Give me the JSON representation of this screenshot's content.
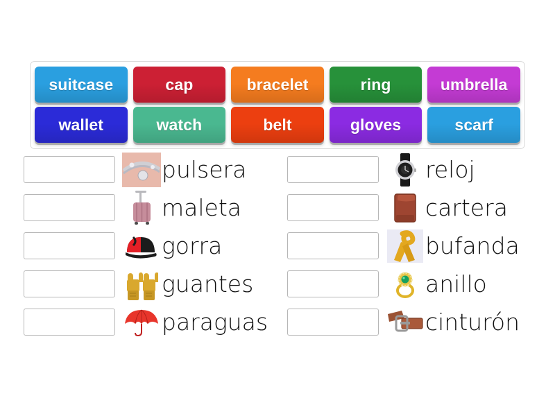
{
  "activity": {
    "type": "match-up",
    "language_pair": "English-Spanish",
    "topic": "clothing-and-accessories"
  },
  "wordbank": {
    "rows": [
      [
        {
          "label": "suitcase",
          "color": "#2a9fe0"
        },
        {
          "label": "cap",
          "color": "#cc2034"
        },
        {
          "label": "bracelet",
          "color": "#f57c1f"
        },
        {
          "label": "ring",
          "color": "#27913a"
        },
        {
          "label": "umbrella",
          "color": "#c43bd4"
        }
      ],
      [
        {
          "label": "wallet",
          "color": "#2b2bd8"
        },
        {
          "label": "watch",
          "color": "#4ab890"
        },
        {
          "label": "belt",
          "color": "#ec3f10"
        },
        {
          "label": "gloves",
          "color": "#8b2be2"
        },
        {
          "label": "scarf",
          "color": "#2a9fe0"
        }
      ]
    ]
  },
  "columns": {
    "left": [
      {
        "term": "pulsera",
        "image": "bracelet-photo",
        "answer": ""
      },
      {
        "term": "maleta",
        "image": "suitcase-photo",
        "answer": ""
      },
      {
        "term": "gorra",
        "image": "cap-photo",
        "answer": ""
      },
      {
        "term": "guantes",
        "image": "gloves-photo",
        "answer": ""
      },
      {
        "term": "paraguas",
        "image": "umbrella-photo",
        "answer": ""
      }
    ],
    "right": [
      {
        "term": "reloj",
        "image": "watch-photo",
        "answer": ""
      },
      {
        "term": "cartera",
        "image": "wallet-photo",
        "answer": ""
      },
      {
        "term": "bufanda",
        "image": "scarf-photo",
        "answer": ""
      },
      {
        "term": "anillo",
        "image": "ring-photo",
        "answer": ""
      },
      {
        "term": "cinturón",
        "image": "belt-photo",
        "answer": ""
      }
    ]
  },
  "answer_box": {
    "placeholder": ""
  }
}
